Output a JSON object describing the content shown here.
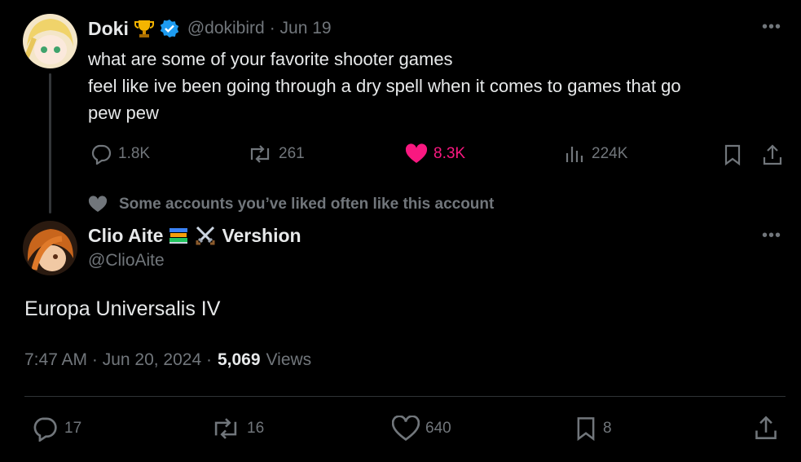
{
  "parent_tweet": {
    "name": "Doki",
    "handle": "@dokibird",
    "date": "· Jun 19",
    "lines": [
      "what are some of your favorite shooter games",
      "feel like ive been going through a dry spell when it comes to games that go",
      "pew pew"
    ],
    "replies": "1.8K",
    "reposts": "261",
    "likes": "8.3K",
    "views": "224K"
  },
  "social_context": "Some accounts you’ve liked often like this account",
  "main_tweet": {
    "name_before": "Clio Aite",
    "name_after": "Vershion",
    "handle": "@ClioAite",
    "text": "Europa Universalis IV",
    "time": "7:47 AM · Jun 20, 2024 ·",
    "views_count": "5,069",
    "views_label": "Views",
    "replies": "17",
    "reposts": "16",
    "likes": "640",
    "bookmarks": "8"
  },
  "colors": {
    "like_active": "#f91880",
    "verified": "#1d9bf0",
    "muted": "#71767b"
  }
}
